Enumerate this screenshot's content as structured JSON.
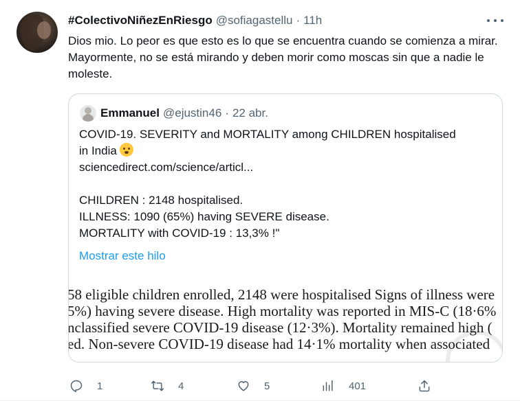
{
  "tweet": {
    "display_name": "#ColectivoNiñezEnRiesgo",
    "handle": "@sofiagastellu",
    "separator": "·",
    "time": "11h",
    "text": "Dios mio. Lo peor es que esto es lo que se encuentra cuando se comienza a mirar. Mayormente, no se está mirando y deben morir como moscas sin que a nadie le moleste."
  },
  "quoted": {
    "display_name": "Emmanuel",
    "handle": "@ejustin46",
    "separator": "·",
    "time": "22 abr.",
    "lines": [
      "COVID-19. SEVERITY and MORTALITY among CHILDREN hospitalised",
      "in India",
      "sciencedirect.com/science/articl...",
      "",
      "CHILDREN : 2148 hospitalised.",
      "ILLNESS: 1090 (65%) having SEVERE disease.",
      "MORTALITY with COVID-19 : 13,3% !\""
    ],
    "show_thread": "Mostrar este hilo",
    "image_text": [
      "58 eligible children enrolled, 2148 were hospitalised  Signs of illness were",
      "5%) having severe disease. High mortality was reported in MIS-C (18·6%",
      "nclassified severe COVID-19 disease (12·3%).  Mortality remained high (",
      "ed. Non-severe COVID-19 disease had 14·1% mortality when associated"
    ]
  },
  "actions": {
    "reply_count": "1",
    "retweet_count": "4",
    "like_count": "5",
    "views_count": "401"
  },
  "colors": {
    "text": "#0f1419",
    "secondary": "#536471",
    "link": "#1d9bf0",
    "border": "#cfd9de"
  }
}
